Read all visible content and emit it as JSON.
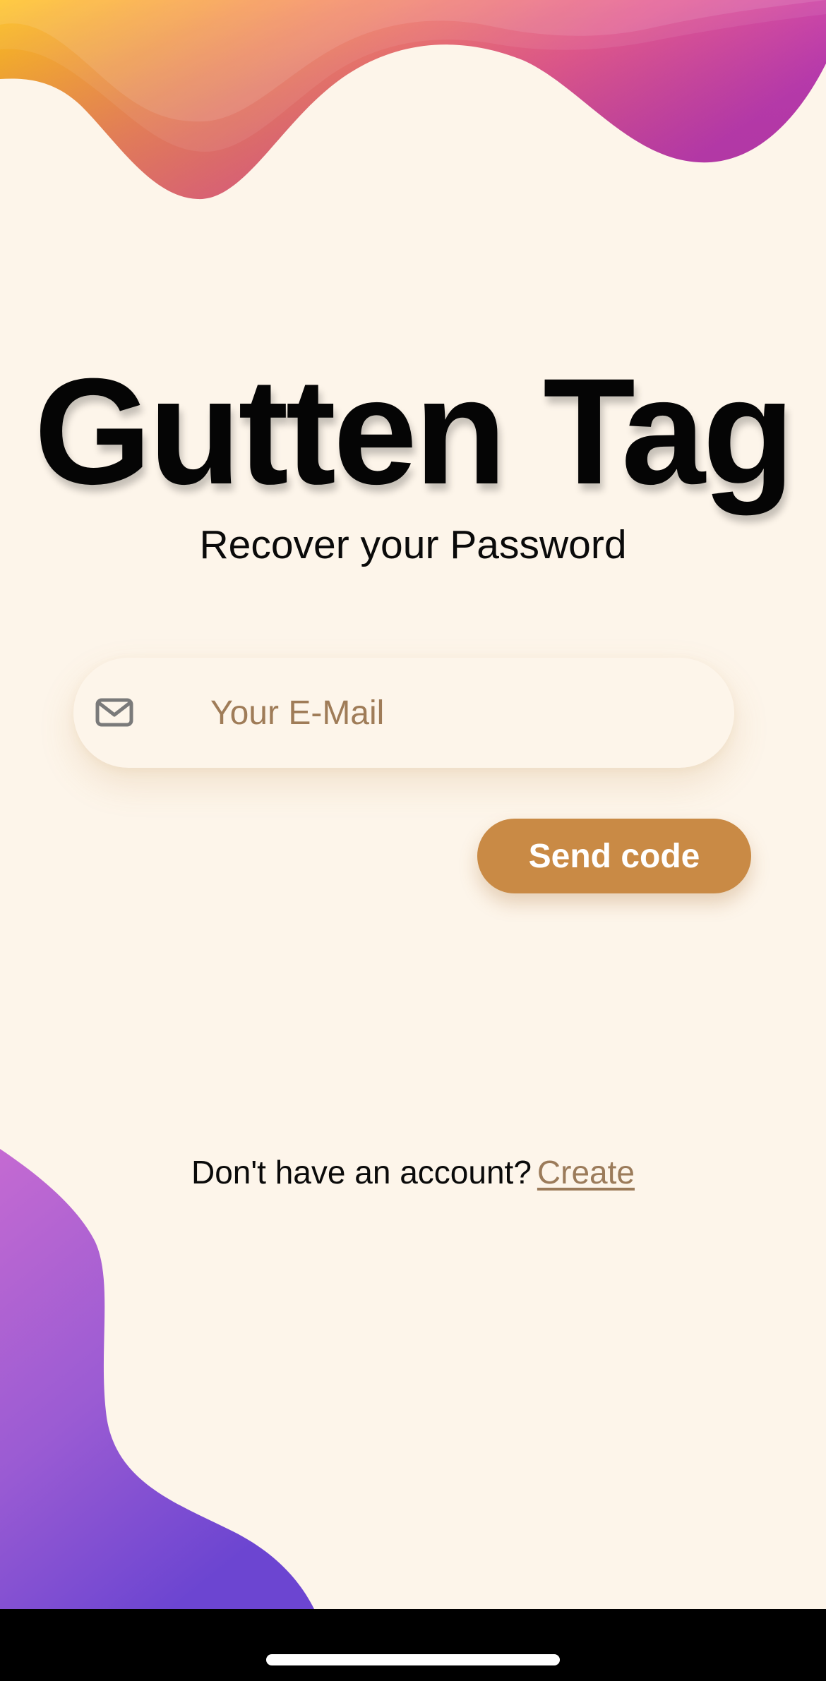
{
  "header": {
    "title": "Gutten Tag",
    "subtitle": "Recover your Password"
  },
  "form": {
    "email_placeholder": "Your E-Mail",
    "email_value": "",
    "email_icon": "mail-icon",
    "send_button_label": "Send code"
  },
  "footer": {
    "prompt": "Don't have an account?",
    "create_link_label": "Create"
  },
  "colors": {
    "background": "#fdf5ea",
    "accent": "#c98a45",
    "link": "#9b7b5a",
    "wave_gradient": [
      "#ffc11e",
      "#f57e62",
      "#de4aa4",
      "#c03db4"
    ],
    "blob_gradient": [
      "#c46ad2",
      "#9a5bd3",
      "#6c45d1"
    ]
  }
}
